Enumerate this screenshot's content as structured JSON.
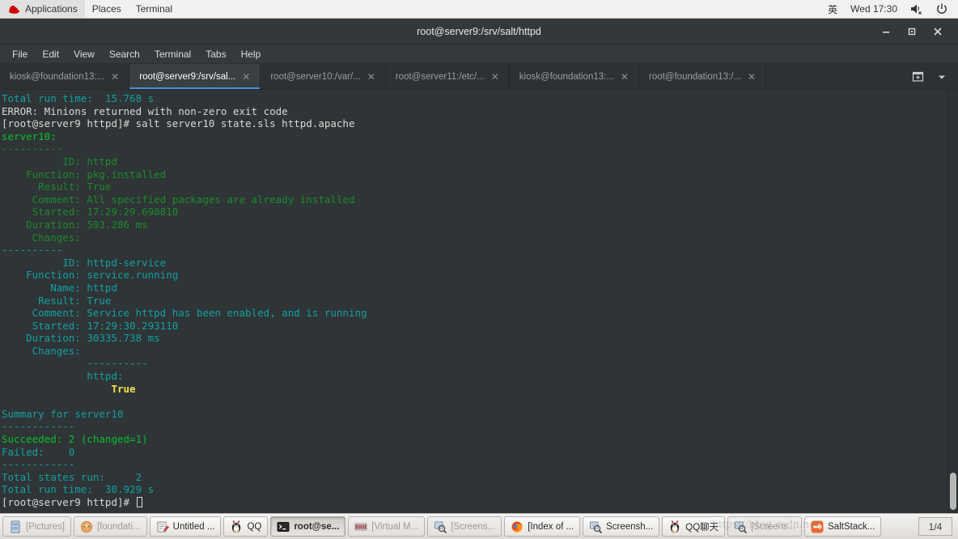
{
  "panel": {
    "logo_name": "redhat-logo",
    "menus": [
      "Applications",
      "Places",
      "Terminal"
    ],
    "input_method": "英",
    "clock": "Wed 17:30",
    "volume_icon": "volume-muted-icon",
    "power_icon": "power-icon"
  },
  "window": {
    "title": "root@server9:/srv/salt/httpd",
    "minimize": "—",
    "maximize": "□",
    "close": "✕"
  },
  "menubar": [
    "File",
    "Edit",
    "View",
    "Search",
    "Terminal",
    "Tabs",
    "Help"
  ],
  "tabs": [
    {
      "label": "kiosk@foundation13:...",
      "active": false
    },
    {
      "label": "root@server9:/srv/sal...",
      "active": true
    },
    {
      "label": "root@server10:/var/...",
      "active": false
    },
    {
      "label": "root@server11:/etc/...",
      "active": false
    },
    {
      "label": "kiosk@foundation13:...",
      "active": false
    },
    {
      "label": "root@foundation13:/...",
      "active": false
    }
  ],
  "tab_close_glyph": "✕",
  "tab_actions": {
    "new_tab_icon": "new-tab-icon",
    "tab_list_icon": "chevron-down-icon"
  },
  "terminal": {
    "lines": [
      [
        {
          "t": "Total run time:  15.768 s",
          "c": "c-cyan"
        }
      ],
      [
        {
          "t": "ERROR: Minions returned with non-zero exit code",
          "c": "c-white"
        }
      ],
      [
        {
          "t": "[root@server9 httpd]# salt server10 state.sls httpd.apache",
          "c": "c-white"
        }
      ],
      [
        {
          "t": "server10:",
          "c": "c-green"
        }
      ],
      [
        {
          "t": "----------",
          "c": "c-dgreen"
        }
      ],
      [
        {
          "t": "          ID: httpd",
          "c": "c-dgreen"
        }
      ],
      [
        {
          "t": "    Function: pkg.installed",
          "c": "c-dgreen"
        }
      ],
      [
        {
          "t": "      Result: True",
          "c": "c-dgreen"
        }
      ],
      [
        {
          "t": "     Comment: All specified packages are already installed",
          "c": "c-dgreen"
        }
      ],
      [
        {
          "t": "     Started: 17:29:29.698810",
          "c": "c-dgreen"
        }
      ],
      [
        {
          "t": "    Duration: 593.286 ms",
          "c": "c-dgreen"
        }
      ],
      [
        {
          "t": "     Changes:   ",
          "c": "c-dgreen"
        }
      ],
      [
        {
          "t": "----------",
          "c": "c-cyan"
        }
      ],
      [
        {
          "t": "          ID: httpd-service",
          "c": "c-cyan"
        }
      ],
      [
        {
          "t": "    Function: service.running",
          "c": "c-cyan"
        }
      ],
      [
        {
          "t": "        Name: httpd",
          "c": "c-cyan"
        }
      ],
      [
        {
          "t": "      Result: True",
          "c": "c-cyan"
        }
      ],
      [
        {
          "t": "     Comment: Service httpd has been enabled, and is running",
          "c": "c-cyan"
        }
      ],
      [
        {
          "t": "     Started: 17:29:30.293110",
          "c": "c-cyan"
        }
      ],
      [
        {
          "t": "    Duration: 30335.738 ms",
          "c": "c-cyan"
        }
      ],
      [
        {
          "t": "     Changes:   ",
          "c": "c-cyan"
        }
      ],
      [
        {
          "t": "              ----------",
          "c": "c-cyan"
        }
      ],
      [
        {
          "t": "              httpd:",
          "c": "c-cyan"
        }
      ],
      [
        {
          "t": "                  ",
          "c": "c-cyan"
        },
        {
          "t": "True",
          "c": "c-yellow"
        }
      ],
      [
        {
          "t": "",
          "c": "c-white"
        }
      ],
      [
        {
          "t": "Summary for server10",
          "c": "c-cyan"
        }
      ],
      [
        {
          "t": "------------",
          "c": "c-cyan"
        }
      ],
      [
        {
          "t": "Succeeded: 2 (changed=1)",
          "c": "c-green"
        }
      ],
      [
        {
          "t": "Failed:    0",
          "c": "c-cyan"
        }
      ],
      [
        {
          "t": "------------",
          "c": "c-cyan"
        }
      ],
      [
        {
          "t": "Total states run:     2",
          "c": "c-cyan"
        }
      ],
      [
        {
          "t": "Total run time:  30.929 s",
          "c": "c-cyan"
        }
      ],
      [
        {
          "t": "[root@server9 httpd]# ",
          "c": "c-white"
        }
      ]
    ]
  },
  "taskbar": {
    "buttons": [
      {
        "label": "[Pictures]",
        "icon": "file-manager-icon",
        "state": "dim"
      },
      {
        "label": "[foundati...",
        "icon": "archive-icon",
        "state": "dim"
      },
      {
        "label": "Untitled ...",
        "icon": "text-editor-icon",
        "state": "normal"
      },
      {
        "label": "QQ",
        "icon": "qq-penguin-icon",
        "state": "normal"
      },
      {
        "label": "root@se...",
        "icon": "terminal-icon",
        "state": "active"
      },
      {
        "label": "[Virtual M...",
        "icon": "virt-manager-icon",
        "state": "dim"
      },
      {
        "label": "[Screens...",
        "icon": "screenshot-icon",
        "state": "dim"
      },
      {
        "label": "[Index of ...",
        "icon": "firefox-icon",
        "state": "normal"
      },
      {
        "label": "Screensh...",
        "icon": "screenshot-icon",
        "state": "normal"
      },
      {
        "label": "QQ聊天",
        "icon": "qq-penguin-icon",
        "state": "normal"
      },
      {
        "label": "[Screens...",
        "icon": "screenshot-icon",
        "state": "dim"
      },
      {
        "label": "SaltStack...",
        "icon": "saltstack-icon",
        "state": "normal"
      }
    ],
    "workspace": "1/4"
  },
  "watermark": "https://blog.csdn.net/"
}
